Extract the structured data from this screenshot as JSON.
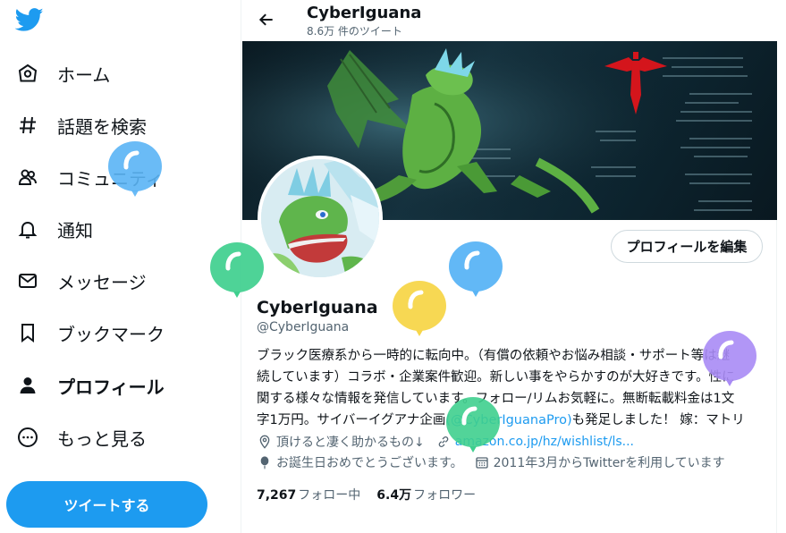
{
  "nav": {
    "items": [
      {
        "label": "ホーム",
        "icon": "home-icon"
      },
      {
        "label": "話題を検索",
        "icon": "hashtag-icon"
      },
      {
        "label": "コミュニティ",
        "icon": "communities-icon"
      },
      {
        "label": "通知",
        "icon": "bell-icon"
      },
      {
        "label": "メッセージ",
        "icon": "mail-icon"
      },
      {
        "label": "ブックマーク",
        "icon": "bookmark-icon"
      },
      {
        "label": "プロフィール",
        "icon": "profile-icon"
      },
      {
        "label": "もっと見る",
        "icon": "more-icon"
      }
    ],
    "tweet_button": "ツイートする"
  },
  "header": {
    "name": "CyberIguana",
    "tweet_count": "8.6万 件のツイート"
  },
  "profile": {
    "edit_button": "プロフィールを編集",
    "name": "CyberIguana",
    "handle": "@CyberIguana",
    "bio_lines": [
      "ブラック医療系から一時的に転向中。（有償の依頼やお悩み相談・サポート等は継",
      "続しています）コラボ・企業案件歓迎。新しい事をやらかすのが大好きです。性に",
      "関する様々な情報を発信しています。フォロー/リムお気軽に。無断転載料金は1文",
      "字1万円。サイバーイグアナ企画"
    ],
    "bio_mention": "@CyberIguanaPro",
    "bio_tail": "も発足しました！ 嫁：マトリ",
    "location": "頂けると凄く助かるもの↓",
    "website": "amazon.co.jp/hz/wishlist/ls...",
    "birthday": "お誕生日おめでとうございます。",
    "joined": "2011年3月からTwitterを利用しています",
    "following_count": "7,267",
    "following_label": "フォロー中",
    "followers_count": "6.4万",
    "followers_label": "フォロワー"
  },
  "colors": {
    "accent": "#1d9bf0",
    "balloon_blue": "#5ab4f5",
    "balloon_green": "#3fcf8e",
    "balloon_yellow": "#f7d64a",
    "balloon_purple": "#a98bf5"
  }
}
